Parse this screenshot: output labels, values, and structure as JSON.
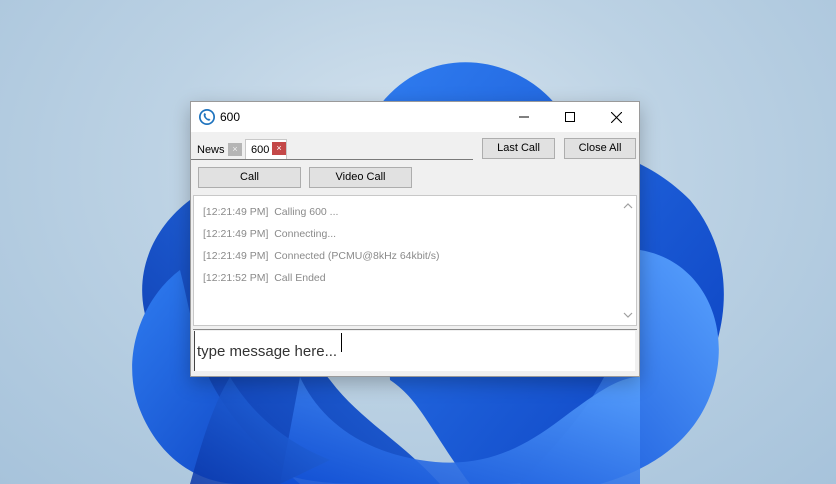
{
  "window": {
    "title": "600"
  },
  "tabs": [
    {
      "label": "News",
      "close_glyph": "×",
      "active": false
    },
    {
      "label": "600",
      "close_glyph": "×",
      "active": true
    }
  ],
  "toolbar": {
    "last_call_label": "Last Call",
    "close_all_label": "Close All",
    "call_label": "Call",
    "video_call_label": "Video Call"
  },
  "log": [
    {
      "time": "[12:21:49 PM]",
      "text": "Calling 600 ..."
    },
    {
      "time": "[12:21:49 PM]",
      "text": "Connecting..."
    },
    {
      "time": "[12:21:49 PM]",
      "text": "Connected (PCMU@8kHz 64kbit/s)"
    },
    {
      "time": "[12:21:52 PM]",
      "text": "Call Ended"
    }
  ],
  "message": {
    "placeholder": "type message here..."
  },
  "colors": {
    "accent_blue": "#1e73be",
    "tab_close_active": "#c44848",
    "tab_close_inactive": "#b5b5b5"
  },
  "icons": [
    "app-phone-icon",
    "minimize-icon",
    "maximize-icon",
    "close-icon",
    "scroll-up-icon",
    "scroll-down-icon"
  ]
}
